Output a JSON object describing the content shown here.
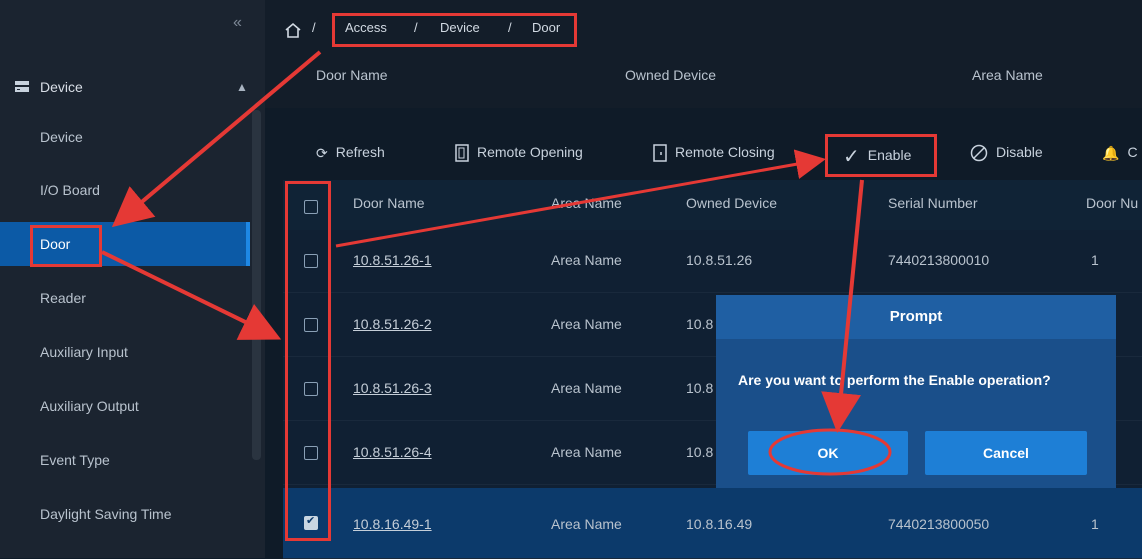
{
  "sidebar": {
    "collapse_glyph": "«",
    "group_label": "Device",
    "items": [
      {
        "label": "Device"
      },
      {
        "label": "I/O Board"
      },
      {
        "label": "Door"
      },
      {
        "label": "Reader"
      },
      {
        "label": "Auxiliary Input"
      },
      {
        "label": "Auxiliary Output"
      },
      {
        "label": "Event Type"
      },
      {
        "label": "Daylight Saving Time"
      }
    ]
  },
  "breadcrumb": {
    "sep": "/",
    "items": [
      "Access",
      "Device",
      "Door"
    ]
  },
  "filter_headers": {
    "door_name": "Door Name",
    "owned_device": "Owned Device",
    "area_name": "Area Name"
  },
  "toolbar": {
    "refresh": "Refresh",
    "remote_opening": "Remote Opening",
    "remote_closing": "Remote Closing",
    "enable": "Enable",
    "disable": "Disable",
    "cut": "C"
  },
  "table": {
    "headers": {
      "door_name": "Door Name",
      "area_name": "Area Name",
      "owned_device": "Owned Device",
      "serial_number": "Serial Number",
      "door_no": "Door Nu"
    },
    "rows": [
      {
        "door_name": "10.8.51.26-1",
        "area_name": "Area Name",
        "owned_device": "10.8.51.26",
        "serial": "7440213800010",
        "door_no": "1"
      },
      {
        "door_name": "10.8.51.26-2",
        "area_name": "Area Name",
        "owned_device": "10.8",
        "serial": "",
        "door_no": ""
      },
      {
        "door_name": "10.8.51.26-3",
        "area_name": "Area Name",
        "owned_device": "10.8",
        "serial": "",
        "door_no": ""
      },
      {
        "door_name": "10.8.51.26-4",
        "area_name": "Area Name",
        "owned_device": "10.8",
        "serial": "",
        "door_no": ""
      },
      {
        "door_name": "10.8.16.49-1",
        "area_name": "Area Name",
        "owned_device": "10.8.16.49",
        "serial": "7440213800050",
        "door_no": "1"
      }
    ]
  },
  "dialog": {
    "title": "Prompt",
    "message": "Are you want to perform the Enable operation?",
    "ok": "OK",
    "cancel": "Cancel"
  },
  "colors": {
    "annotation": "#e53935",
    "accent": "#0c5aa6"
  }
}
